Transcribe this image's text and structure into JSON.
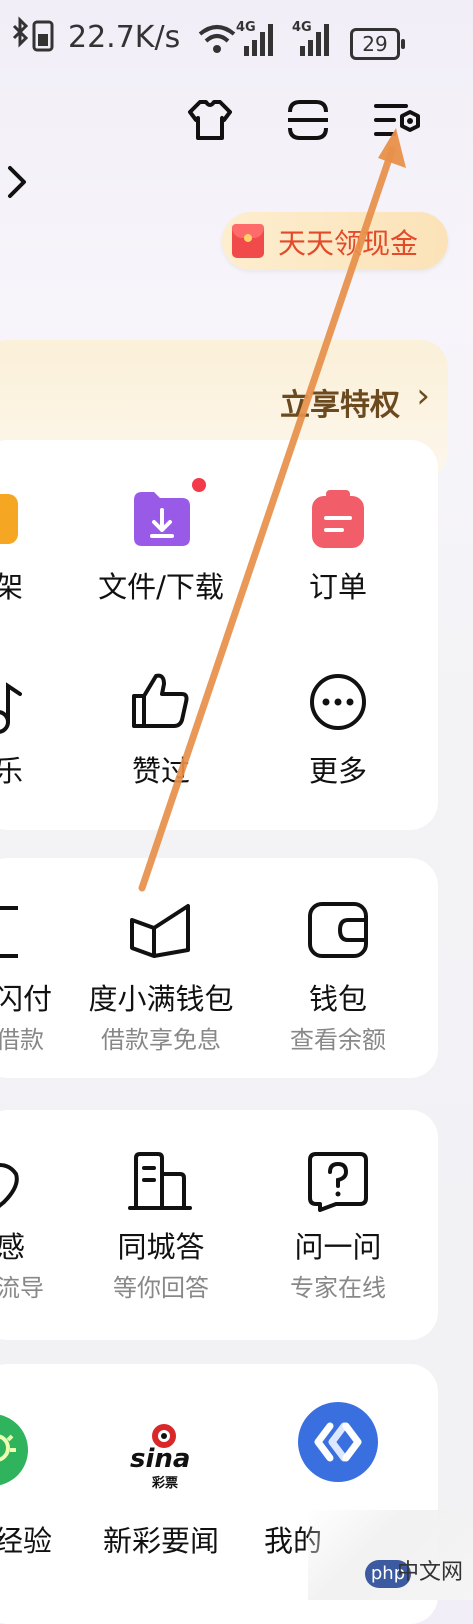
{
  "status_bar": {
    "speed": "22.7K/s",
    "net1": "4G",
    "net2": "4G",
    "battery": "29"
  },
  "header": {
    "red_packet_label": "天天领现金"
  },
  "vip": {
    "label": "立享特权",
    "chevron": "›"
  },
  "grid1": {
    "row1": [
      {
        "label": "架",
        "icon": "bookshelf-icon"
      },
      {
        "label": "文件/下载",
        "icon": "folder-download-icon"
      },
      {
        "label": "订单",
        "icon": "order-icon"
      }
    ],
    "row2": [
      {
        "label": "乐",
        "icon": "music-icon"
      },
      {
        "label": "赞过",
        "icon": "thumbs-up-icon"
      },
      {
        "label": "更多",
        "icon": "more-icon"
      }
    ]
  },
  "finance": [
    {
      "label": "闪付",
      "sub": "借款",
      "icon": "pay-icon"
    },
    {
      "label": "度小满钱包",
      "sub": "借款享免息",
      "icon": "duxiaoman-icon"
    },
    {
      "label": "钱包",
      "sub": "查看余额",
      "icon": "wallet-icon"
    }
  ],
  "services": [
    {
      "label": "感",
      "sub": "流导",
      "icon": "heart-icon"
    },
    {
      "label": "同城答",
      "sub": "等你回答",
      "icon": "building-icon"
    },
    {
      "label": "问一问",
      "sub": "专家在线",
      "icon": "question-icon"
    }
  ],
  "apps": [
    {
      "label": "经验",
      "icon": "experience-icon"
    },
    {
      "label": "新彩要闻",
      "icon": "sina-lottery-icon",
      "logo_text": "sina",
      "logo_sub": "彩票"
    },
    {
      "label": "我的",
      "icon": "blue-app-icon"
    }
  ],
  "watermark": {
    "badge": "php",
    "text": "中文网"
  },
  "colors": {
    "accent_orange": "#e8904a",
    "red_dot": "#f23a4a",
    "vip_text": "#6b4a1f"
  }
}
